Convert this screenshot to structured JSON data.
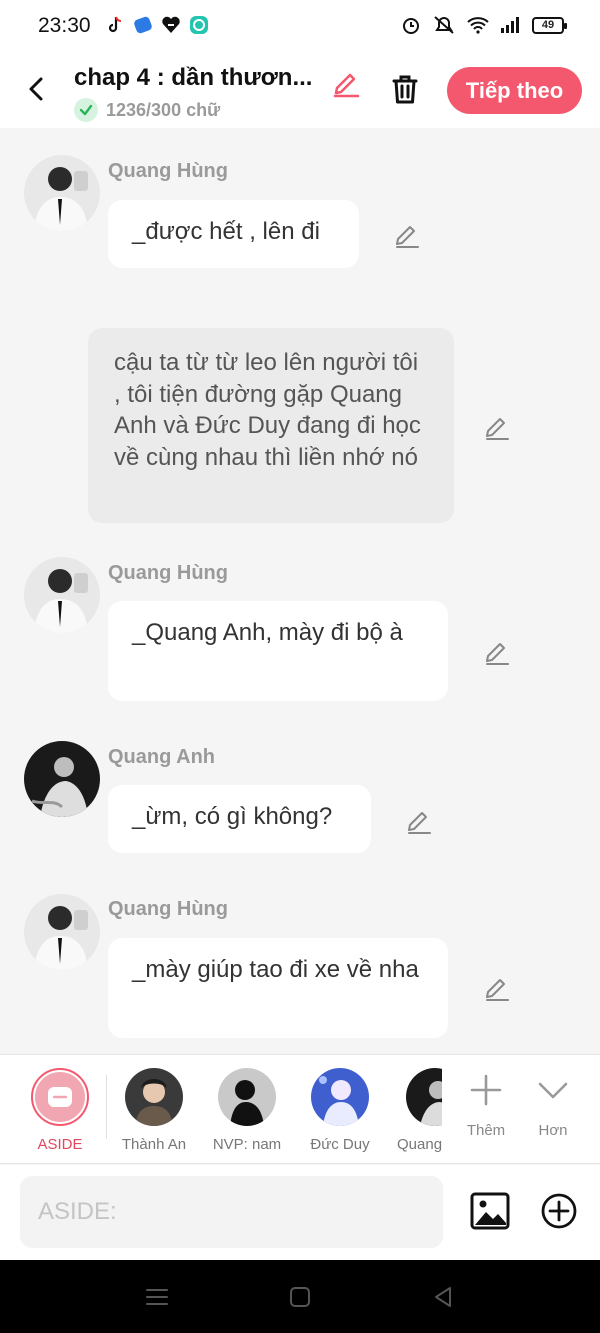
{
  "status_bar": {
    "time": "23:30",
    "battery": "49",
    "icons": [
      "tiktok-icon",
      "blue-app-icon",
      "heart-app-icon",
      "chat-app-icon",
      "alarm-icon",
      "mute-icon",
      "wifi-icon",
      "signal-icon",
      "battery-icon"
    ]
  },
  "header": {
    "title": "chap 4 : dần thươn...",
    "word_count": "1236/300 chữ",
    "next_label": "Tiếp theo",
    "accent": "#f4586e"
  },
  "messages": [
    {
      "kind": "character",
      "name": "Quang Hùng",
      "text": "_được hết , lên đi",
      "avatar": "quang-hung"
    },
    {
      "kind": "aside",
      "text": "cậu ta từ từ leo lên người tôi , tôi tiện đường gặp Quang Anh và Đức Duy đang đi học về cùng nhau thì liền nhớ nó"
    },
    {
      "kind": "character",
      "name": "Quang Hùng",
      "text": "_Quang Anh, mày đi bộ à",
      "avatar": "quang-hung"
    },
    {
      "kind": "character",
      "name": "Quang Anh",
      "text": "_ừm, có gì không?",
      "avatar": "quang-anh"
    },
    {
      "kind": "character",
      "name": "Quang Hùng",
      "text": "_mày giúp tao đi xe về nha",
      "avatar": "quang-hung"
    }
  ],
  "characters": [
    {
      "name": "ASIDE",
      "selected": true
    },
    {
      "name": "Thành An"
    },
    {
      "name": "NVP: nam"
    },
    {
      "name": "Đức Duy"
    },
    {
      "name": "Quang"
    }
  ],
  "tools": {
    "add_label": "Thêm",
    "more_label": "Hơn"
  },
  "input": {
    "placeholder": "ASIDE:",
    "value": ""
  }
}
